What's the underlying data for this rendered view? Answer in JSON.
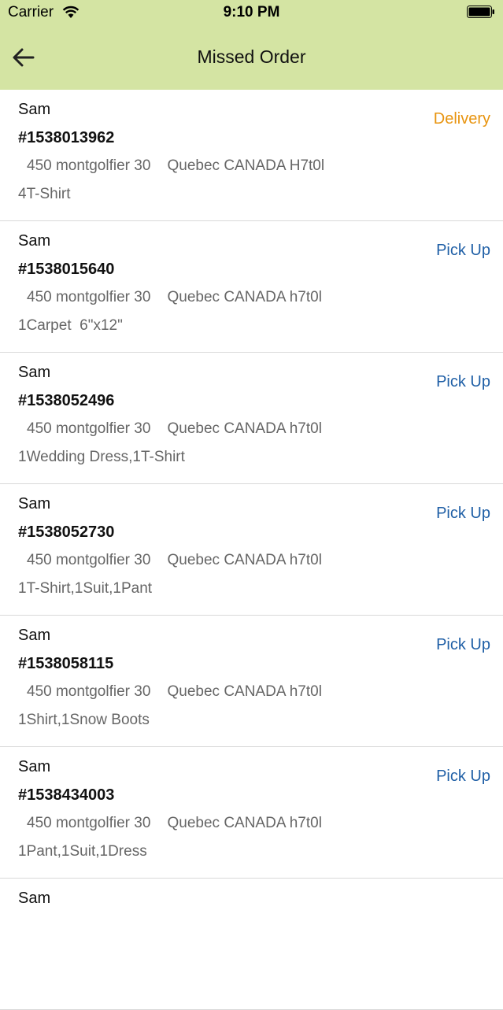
{
  "status_bar": {
    "carrier": "Carrier",
    "time": "9:10 PM"
  },
  "nav": {
    "title": "Missed Order",
    "back_icon": "back-arrow-icon"
  },
  "colors": {
    "header_bg": "#d4e4a3",
    "delivery": "#e8940f",
    "pickup": "#1f5fa6"
  },
  "orders": [
    {
      "name": "Sam",
      "number": "#1538013962",
      "address": "450 montgolfier 30    Quebec CANADA H7t0l",
      "items": "4T-Shirt",
      "type": "Delivery"
    },
    {
      "name": "Sam",
      "number": "#1538015640",
      "address": "450 montgolfier 30    Quebec CANADA h7t0l",
      "items": "1Carpet  6\"x12\"",
      "type": "Pick Up"
    },
    {
      "name": "Sam",
      "number": "#1538052496",
      "address": "450 montgolfier 30    Quebec CANADA h7t0l",
      "items": "1Wedding Dress,1T-Shirt",
      "type": "Pick Up"
    },
    {
      "name": "Sam",
      "number": "#1538052730",
      "address": "450 montgolfier 30    Quebec CANADA h7t0l",
      "items": "1T-Shirt,1Suit,1Pant",
      "type": "Pick Up"
    },
    {
      "name": "Sam",
      "number": "#1538058115",
      "address": "450 montgolfier 30    Quebec CANADA h7t0l",
      "items": "1Shirt,1Snow Boots",
      "type": "Pick Up"
    },
    {
      "name": "Sam",
      "number": "#1538434003",
      "address": "450 montgolfier 30    Quebec CANADA h7t0l",
      "items": "1Pant,1Suit,1Dress",
      "type": "Pick Up"
    }
  ]
}
